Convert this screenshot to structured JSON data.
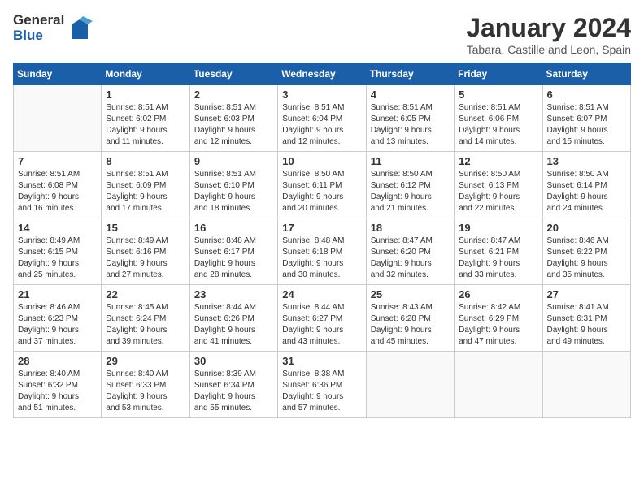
{
  "header": {
    "logo_general": "General",
    "logo_blue": "Blue",
    "month": "January 2024",
    "location": "Tabara, Castille and Leon, Spain"
  },
  "weekdays": [
    "Sunday",
    "Monday",
    "Tuesday",
    "Wednesday",
    "Thursday",
    "Friday",
    "Saturday"
  ],
  "weeks": [
    [
      {
        "day": "",
        "info": ""
      },
      {
        "day": "1",
        "info": "Sunrise: 8:51 AM\nSunset: 6:02 PM\nDaylight: 9 hours\nand 11 minutes."
      },
      {
        "day": "2",
        "info": "Sunrise: 8:51 AM\nSunset: 6:03 PM\nDaylight: 9 hours\nand 12 minutes."
      },
      {
        "day": "3",
        "info": "Sunrise: 8:51 AM\nSunset: 6:04 PM\nDaylight: 9 hours\nand 12 minutes."
      },
      {
        "day": "4",
        "info": "Sunrise: 8:51 AM\nSunset: 6:05 PM\nDaylight: 9 hours\nand 13 minutes."
      },
      {
        "day": "5",
        "info": "Sunrise: 8:51 AM\nSunset: 6:06 PM\nDaylight: 9 hours\nand 14 minutes."
      },
      {
        "day": "6",
        "info": "Sunrise: 8:51 AM\nSunset: 6:07 PM\nDaylight: 9 hours\nand 15 minutes."
      }
    ],
    [
      {
        "day": "7",
        "info": "Sunrise: 8:51 AM\nSunset: 6:08 PM\nDaylight: 9 hours\nand 16 minutes."
      },
      {
        "day": "8",
        "info": "Sunrise: 8:51 AM\nSunset: 6:09 PM\nDaylight: 9 hours\nand 17 minutes."
      },
      {
        "day": "9",
        "info": "Sunrise: 8:51 AM\nSunset: 6:10 PM\nDaylight: 9 hours\nand 18 minutes."
      },
      {
        "day": "10",
        "info": "Sunrise: 8:50 AM\nSunset: 6:11 PM\nDaylight: 9 hours\nand 20 minutes."
      },
      {
        "day": "11",
        "info": "Sunrise: 8:50 AM\nSunset: 6:12 PM\nDaylight: 9 hours\nand 21 minutes."
      },
      {
        "day": "12",
        "info": "Sunrise: 8:50 AM\nSunset: 6:13 PM\nDaylight: 9 hours\nand 22 minutes."
      },
      {
        "day": "13",
        "info": "Sunrise: 8:50 AM\nSunset: 6:14 PM\nDaylight: 9 hours\nand 24 minutes."
      }
    ],
    [
      {
        "day": "14",
        "info": "Sunrise: 8:49 AM\nSunset: 6:15 PM\nDaylight: 9 hours\nand 25 minutes."
      },
      {
        "day": "15",
        "info": "Sunrise: 8:49 AM\nSunset: 6:16 PM\nDaylight: 9 hours\nand 27 minutes."
      },
      {
        "day": "16",
        "info": "Sunrise: 8:48 AM\nSunset: 6:17 PM\nDaylight: 9 hours\nand 28 minutes."
      },
      {
        "day": "17",
        "info": "Sunrise: 8:48 AM\nSunset: 6:18 PM\nDaylight: 9 hours\nand 30 minutes."
      },
      {
        "day": "18",
        "info": "Sunrise: 8:47 AM\nSunset: 6:20 PM\nDaylight: 9 hours\nand 32 minutes."
      },
      {
        "day": "19",
        "info": "Sunrise: 8:47 AM\nSunset: 6:21 PM\nDaylight: 9 hours\nand 33 minutes."
      },
      {
        "day": "20",
        "info": "Sunrise: 8:46 AM\nSunset: 6:22 PM\nDaylight: 9 hours\nand 35 minutes."
      }
    ],
    [
      {
        "day": "21",
        "info": "Sunrise: 8:46 AM\nSunset: 6:23 PM\nDaylight: 9 hours\nand 37 minutes."
      },
      {
        "day": "22",
        "info": "Sunrise: 8:45 AM\nSunset: 6:24 PM\nDaylight: 9 hours\nand 39 minutes."
      },
      {
        "day": "23",
        "info": "Sunrise: 8:44 AM\nSunset: 6:26 PM\nDaylight: 9 hours\nand 41 minutes."
      },
      {
        "day": "24",
        "info": "Sunrise: 8:44 AM\nSunset: 6:27 PM\nDaylight: 9 hours\nand 43 minutes."
      },
      {
        "day": "25",
        "info": "Sunrise: 8:43 AM\nSunset: 6:28 PM\nDaylight: 9 hours\nand 45 minutes."
      },
      {
        "day": "26",
        "info": "Sunrise: 8:42 AM\nSunset: 6:29 PM\nDaylight: 9 hours\nand 47 minutes."
      },
      {
        "day": "27",
        "info": "Sunrise: 8:41 AM\nSunset: 6:31 PM\nDaylight: 9 hours\nand 49 minutes."
      }
    ],
    [
      {
        "day": "28",
        "info": "Sunrise: 8:40 AM\nSunset: 6:32 PM\nDaylight: 9 hours\nand 51 minutes."
      },
      {
        "day": "29",
        "info": "Sunrise: 8:40 AM\nSunset: 6:33 PM\nDaylight: 9 hours\nand 53 minutes."
      },
      {
        "day": "30",
        "info": "Sunrise: 8:39 AM\nSunset: 6:34 PM\nDaylight: 9 hours\nand 55 minutes."
      },
      {
        "day": "31",
        "info": "Sunrise: 8:38 AM\nSunset: 6:36 PM\nDaylight: 9 hours\nand 57 minutes."
      },
      {
        "day": "",
        "info": ""
      },
      {
        "day": "",
        "info": ""
      },
      {
        "day": "",
        "info": ""
      }
    ]
  ]
}
